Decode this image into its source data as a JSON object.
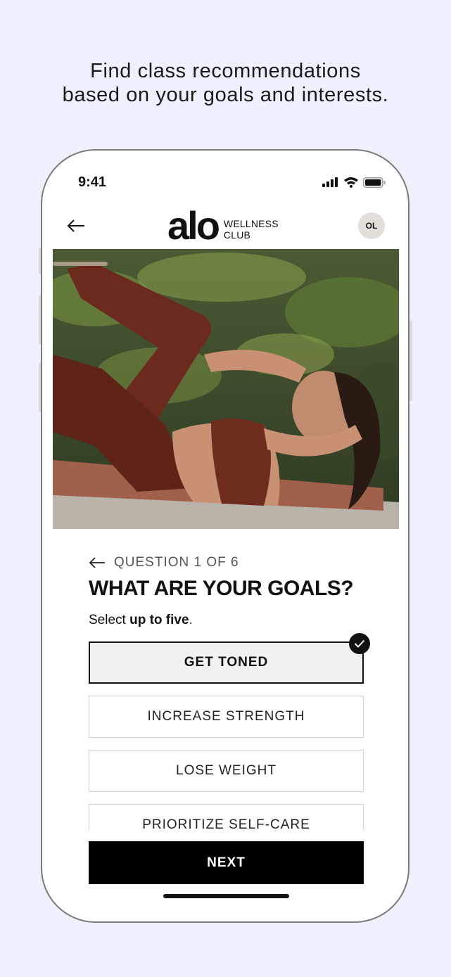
{
  "promo": {
    "line1": "Find class recommendations",
    "line2": "based on your goals and interests."
  },
  "status_bar": {
    "time": "9:41"
  },
  "header": {
    "logo_text": "alo",
    "logo_sub1": "WELLNESS",
    "logo_sub2": "CLUB",
    "avatar_initials": "OL"
  },
  "question": {
    "counter": "QUESTION 1 OF 6",
    "title": "WHAT ARE YOUR GOALS?",
    "subtitle_prefix": "Select ",
    "subtitle_bold": "up to five",
    "subtitle_suffix": "."
  },
  "options": [
    {
      "label": "GET TONED",
      "selected": true
    },
    {
      "label": "INCREASE STRENGTH",
      "selected": false
    },
    {
      "label": "LOSE WEIGHT",
      "selected": false
    },
    {
      "label": "PRIORITIZE SELF-CARE",
      "selected": false
    }
  ],
  "next_label": "NEXT",
  "colors": {
    "background": "#eef0fd",
    "accent": "#000000"
  }
}
